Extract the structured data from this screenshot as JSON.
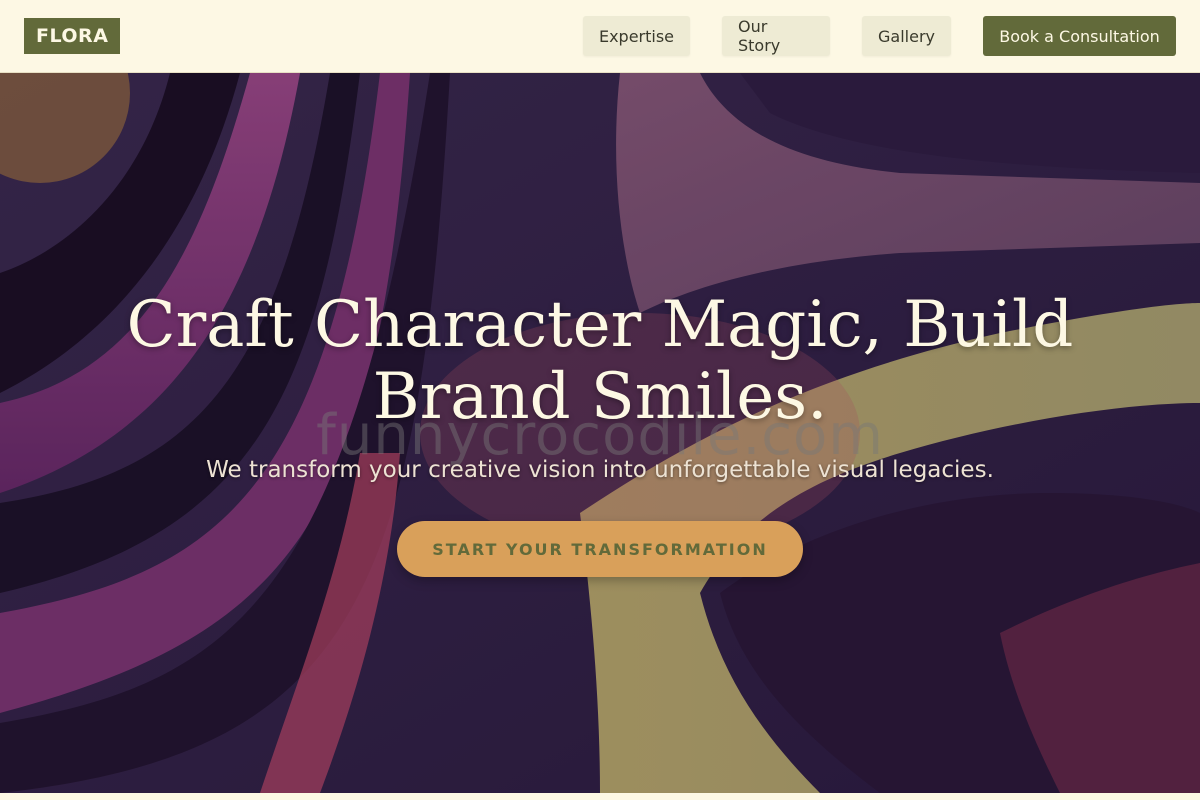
{
  "header": {
    "logo": "FLORA",
    "nav": [
      {
        "label": "Expertise"
      },
      {
        "label": "Our Story"
      },
      {
        "label": "Gallery"
      }
    ],
    "cta_label": "Book a Consultation"
  },
  "hero": {
    "title": "Craft Character Magic, Build Brand Smiles.",
    "subtitle": "We transform your creative vision into unforgettable visual legacies.",
    "cta_label": "START YOUR TRANSFORMATION",
    "watermark": "funnycrocodile.com"
  },
  "colors": {
    "brand": "#626a3a",
    "background": "#fdf8e4",
    "cta_orange": "#d9a05a",
    "hero_dark": "#2a1b3f"
  },
  "icons": []
}
